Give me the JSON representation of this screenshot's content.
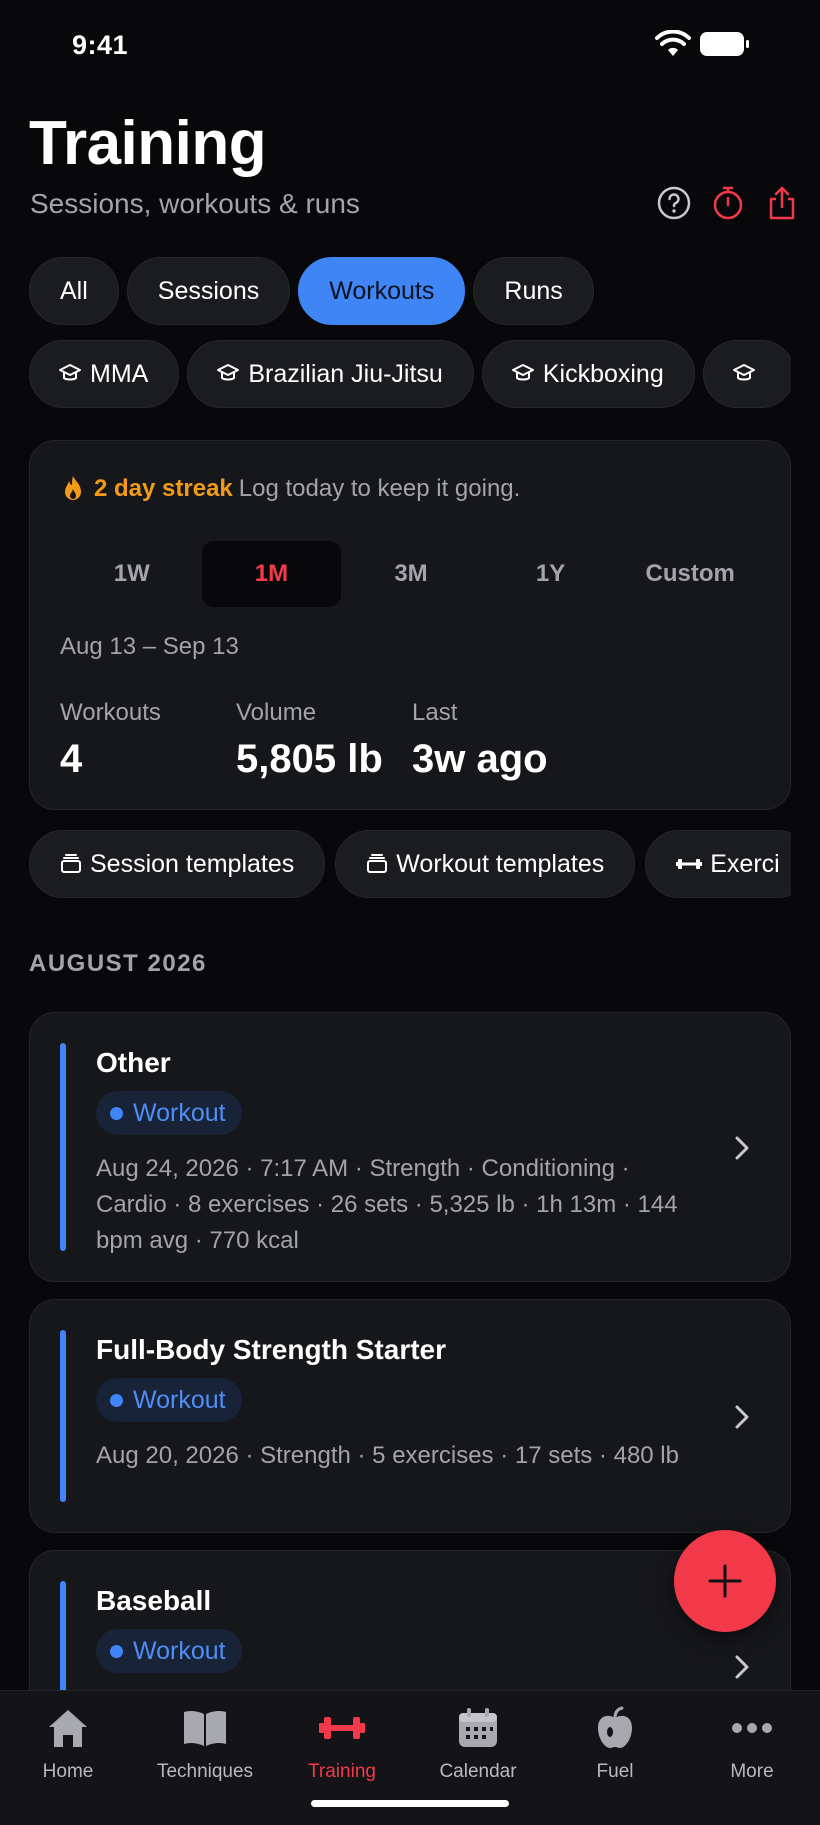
{
  "status": {
    "time": "9:41"
  },
  "header": {
    "title": "Training",
    "subtitle": "Sessions, workouts & runs"
  },
  "filters": [
    {
      "label": "All",
      "active": false
    },
    {
      "label": "Sessions",
      "active": false
    },
    {
      "label": "Workouts",
      "active": true
    },
    {
      "label": "Runs",
      "active": false
    }
  ],
  "sports": [
    "MMA",
    "Brazilian Jiu-Jitsu",
    "Kickboxing",
    ""
  ],
  "stats": {
    "streak_bold": "2 day streak",
    "streak_text": "Log today to keep it going.",
    "ranges": [
      "1W",
      "1M",
      "3M",
      "1Y",
      "Custom"
    ],
    "active_range": "1M",
    "date_range": "Aug 13 – Sep 13",
    "workouts_label": "Workouts",
    "workouts_value": "4",
    "volume_label": "Volume",
    "volume_value": "5,805 lb",
    "last_label": "Last",
    "last_value": "3w ago"
  },
  "templates": [
    "Session templates",
    "Workout templates",
    "Exerci"
  ],
  "section": {
    "title": "AUGUST 2026"
  },
  "sessions": [
    {
      "title": "Other",
      "badge": "Workout",
      "meta": "Aug 24, 2026 · 7:17 AM · Strength · Conditioning · Cardio · 8 exercises · 26 sets · 5,325 lb · 1h 13m · 144 bpm avg · 770 kcal"
    },
    {
      "title": "Full-Body Strength Starter",
      "badge": "Workout",
      "meta": "Aug 20, 2026 · Strength · 5 exercises · 17 sets · 480 lb"
    },
    {
      "title": "Baseball",
      "badge": "Workout",
      "meta": ""
    }
  ],
  "tabs": [
    {
      "label": "Home",
      "icon": "home-icon"
    },
    {
      "label": "Techniques",
      "icon": "book-icon"
    },
    {
      "label": "Training",
      "icon": "dumbbell-icon",
      "active": true
    },
    {
      "label": "Calendar",
      "icon": "calendar-icon"
    },
    {
      "label": "Fuel",
      "icon": "apple-icon"
    },
    {
      "label": "More",
      "icon": "more-icon"
    }
  ],
  "colors": {
    "accent": "#3f85f5",
    "brand": "#f2394a",
    "streak": "#f29b16",
    "background": "#08080a",
    "card": "#16171b"
  }
}
